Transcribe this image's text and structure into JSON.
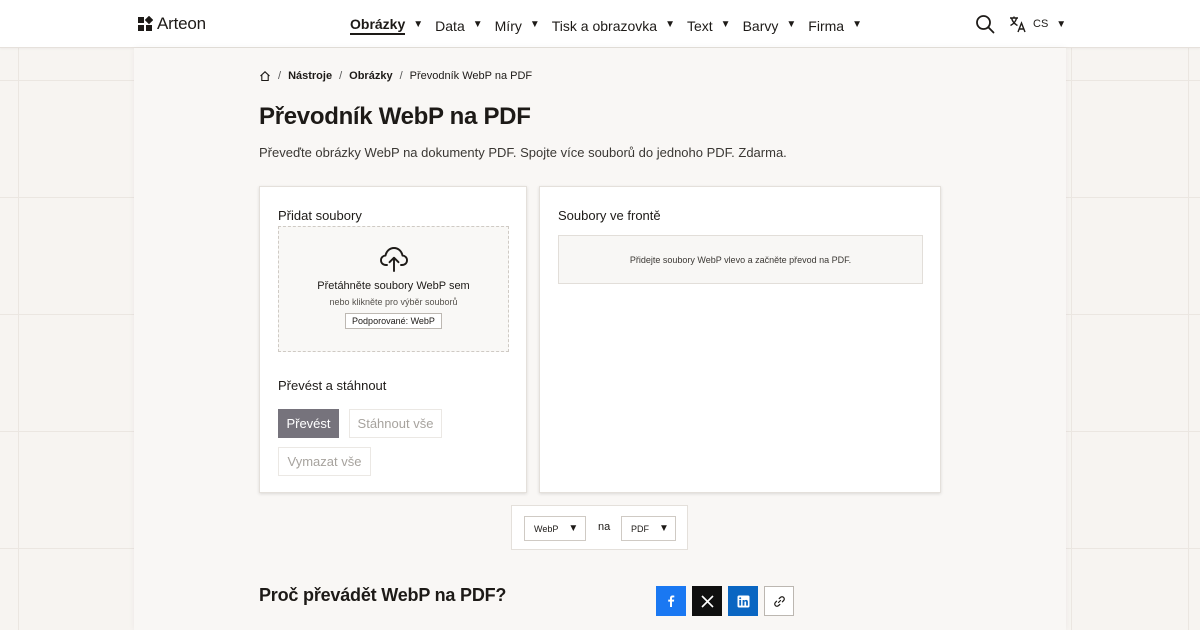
{
  "header": {
    "logo_text": "Arteon",
    "nav": [
      {
        "label": "Obrázky",
        "active": true
      },
      {
        "label": "Data"
      },
      {
        "label": "Míry"
      },
      {
        "label": "Tisk a obrazovka"
      },
      {
        "label": "Text"
      },
      {
        "label": "Barvy"
      },
      {
        "label": "Firma"
      }
    ],
    "lang_code": "CS",
    "caret": "▼"
  },
  "breadcrumb": {
    "items": [
      "Nástroje",
      "Obrázky"
    ],
    "current": "Převodník WebP na PDF",
    "separator": "/"
  },
  "page": {
    "title": "Převodník WebP na PDF",
    "subtitle": "Převeďte obrázky WebP na dokumenty PDF. Spojte více souborů do jednoho PDF. Zdarma."
  },
  "upload": {
    "heading": "Přidat soubory",
    "drop_title": "Přetáhněte soubory WebP sem",
    "drop_sub": "nebo klikněte pro výběr souborů",
    "supported": "Podporované: WebP"
  },
  "convert": {
    "heading": "Převést a stáhnout",
    "convert_label": "Převést",
    "download_label": "Stáhnout vše",
    "clear_label": "Vymazat vše"
  },
  "queue": {
    "heading": "Soubory ve frontě",
    "empty_text": "Přidejte soubory WebP vlevo a začněte převod na PDF."
  },
  "format": {
    "from": "WebP",
    "connector": "na",
    "to": "PDF"
  },
  "faq": {
    "heading": "Proč převádět WebP na PDF?"
  },
  "colors": {
    "facebook": "#1a78f2",
    "x": "#0f0f0f",
    "linkedin": "#0a66c2",
    "primary_button": "#76737c"
  }
}
